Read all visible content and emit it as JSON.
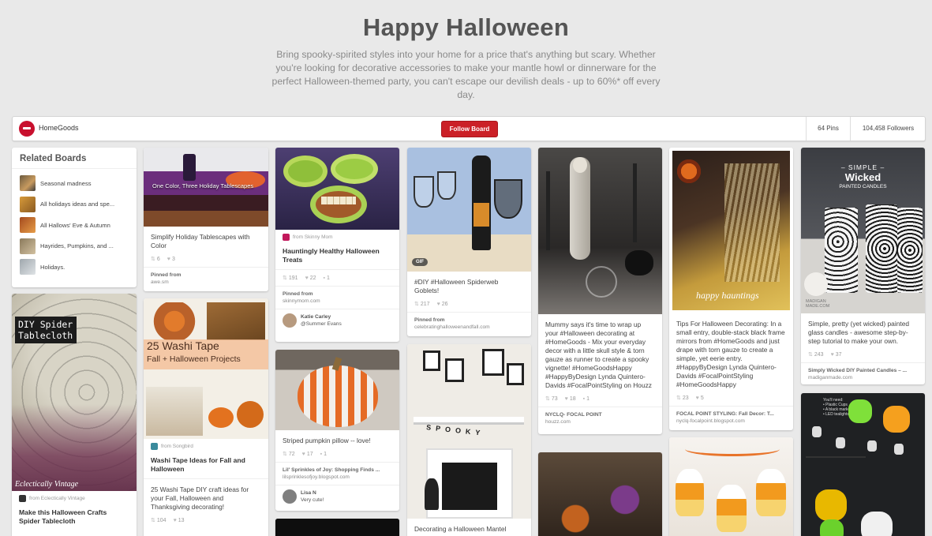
{
  "hero": {
    "title": "Happy Halloween",
    "description": "Bring spooky-spirited styles into your home for a price that's anything but scary. Whether you're looking for decorative accessories to make your mantle howl or dinnerware for the perfect Halloween-themed party, you can't escape our devilish deals - up to 60%* off every day."
  },
  "board": {
    "owner": "HomeGoods",
    "follow_label": "Follow Board",
    "pins": "64 Pins",
    "followers": "104,458 Followers"
  },
  "related": {
    "heading": "Related Boards",
    "items": [
      {
        "label": "Seasonal madness"
      },
      {
        "label": "All holidays ideas and spe..."
      },
      {
        "label": "All Hallows' Eve & Autumn"
      },
      {
        "label": "Hayrides, Pumpkins, and ..."
      },
      {
        "label": "Holidays."
      }
    ]
  },
  "pins": {
    "tablecloth": {
      "overlay": "DIY Spider Tablecloth",
      "watermark": "Eclectically Vintage",
      "via": "from Eclectically Vintage",
      "title": "Make this Halloween Crafts Spider Tablecloth"
    },
    "tablescapes": {
      "overlay": "One Color, Three Holiday Tablescapes",
      "desc": "Simplify Holiday Tablescapes with Color",
      "repins": "6",
      "likes": "3",
      "pinned_from": "Pinned from",
      "source": "awe.sm"
    },
    "washi": {
      "overlay_a": "25 Washi Tape",
      "overlay_b": "Fall + Halloween Projects",
      "via": "from Songbird",
      "title": "Washi Tape Ideas for Fall and Halloween",
      "desc": "25 Washi Tape DIY craft ideas for your Fall, Halloween and Thanksgiving decorating!",
      "repins": "104",
      "likes": "13"
    },
    "treats": {
      "via": "from Skinny Mom",
      "title": "Hauntingly Healthy Halloween Treats",
      "repins": "191",
      "likes": "22",
      "comments": "1",
      "pinned_from": "Pinned from",
      "source": "skinnymom.com",
      "pinner_name": "Katie Carley",
      "pinner_board": "@Summer Evans"
    },
    "pillow": {
      "desc": "Striped pumpkin pillow -- love!",
      "repins": "72",
      "likes": "17",
      "comments": "1",
      "source_title": "Lil' Sprinkles of Joy: Shopping Finds ...",
      "source": "lilsprinklesofjoy.blogspot.com",
      "pinner_name": "Lisa N",
      "pinner_note": "Very cute!"
    },
    "goblets": {
      "gif": "GIF",
      "desc": "#DIY #Halloween Spiderweb Goblets!",
      "repins": "217",
      "likes": "26",
      "pinned_from": "Pinned from",
      "source": "celebratinghalloweenandfall.com"
    },
    "mantel": {
      "banner": "SPOOKY",
      "desc": "Decorating a Halloween Mantel"
    },
    "mummy": {
      "desc": "Mummy says it's time to wrap up your #Halloween decorating at #HomeGoods - Mix your everyday decor with a little skull style & torn gauze as runner to create a spooky vignette! #HomeGoodsHappy #HappyByDesign Lynda Quintero-Davids #FocalPointStyling on Houzz",
      "repins": "73",
      "likes": "18",
      "comments": "1",
      "source_title": "NYCLQ- FOCAL POINT",
      "source": "houzz.com"
    },
    "hauntings": {
      "overlay": "happy hauntings",
      "desc": "Tips For Halloween Decorating: In a small entry, double-stack black frame mirrors from #HomeGoods and just drape with torn gauze to create a simple, yet eerie entry. #HappyByDesign Lynda Quintero-Davids #FocalPointStyling #HomeGoodsHappy",
      "repins": "23",
      "likes": "5",
      "source_title": "FOCAL POINT STYLING: Fall Decor: T...",
      "source": "nyclq-focalpoint.blogspot.com"
    },
    "candles": {
      "overlay_small": "– SIMPLE –",
      "overlay_big": "Wicked",
      "overlay_sub": "PAINTED CANDLES",
      "watermark": "MADIGAN MADE.COM",
      "desc": "Simple, pretty (yet wicked) painted glass candles - awesome step-by-step tutorial to make your own.",
      "repins": "243",
      "likes": "37",
      "source_title": "Simply Wicked DIY Painted Candles – ...",
      "source": "madiganmade.com"
    },
    "cups": {
      "note_a": "You'll need:",
      "note_b": "• Plastic Cups",
      "note_c": "• A black marker",
      "note_d": "• LED tealights"
    }
  },
  "colors": {
    "follow": "#cb2027",
    "background": "#e9e9e9"
  }
}
